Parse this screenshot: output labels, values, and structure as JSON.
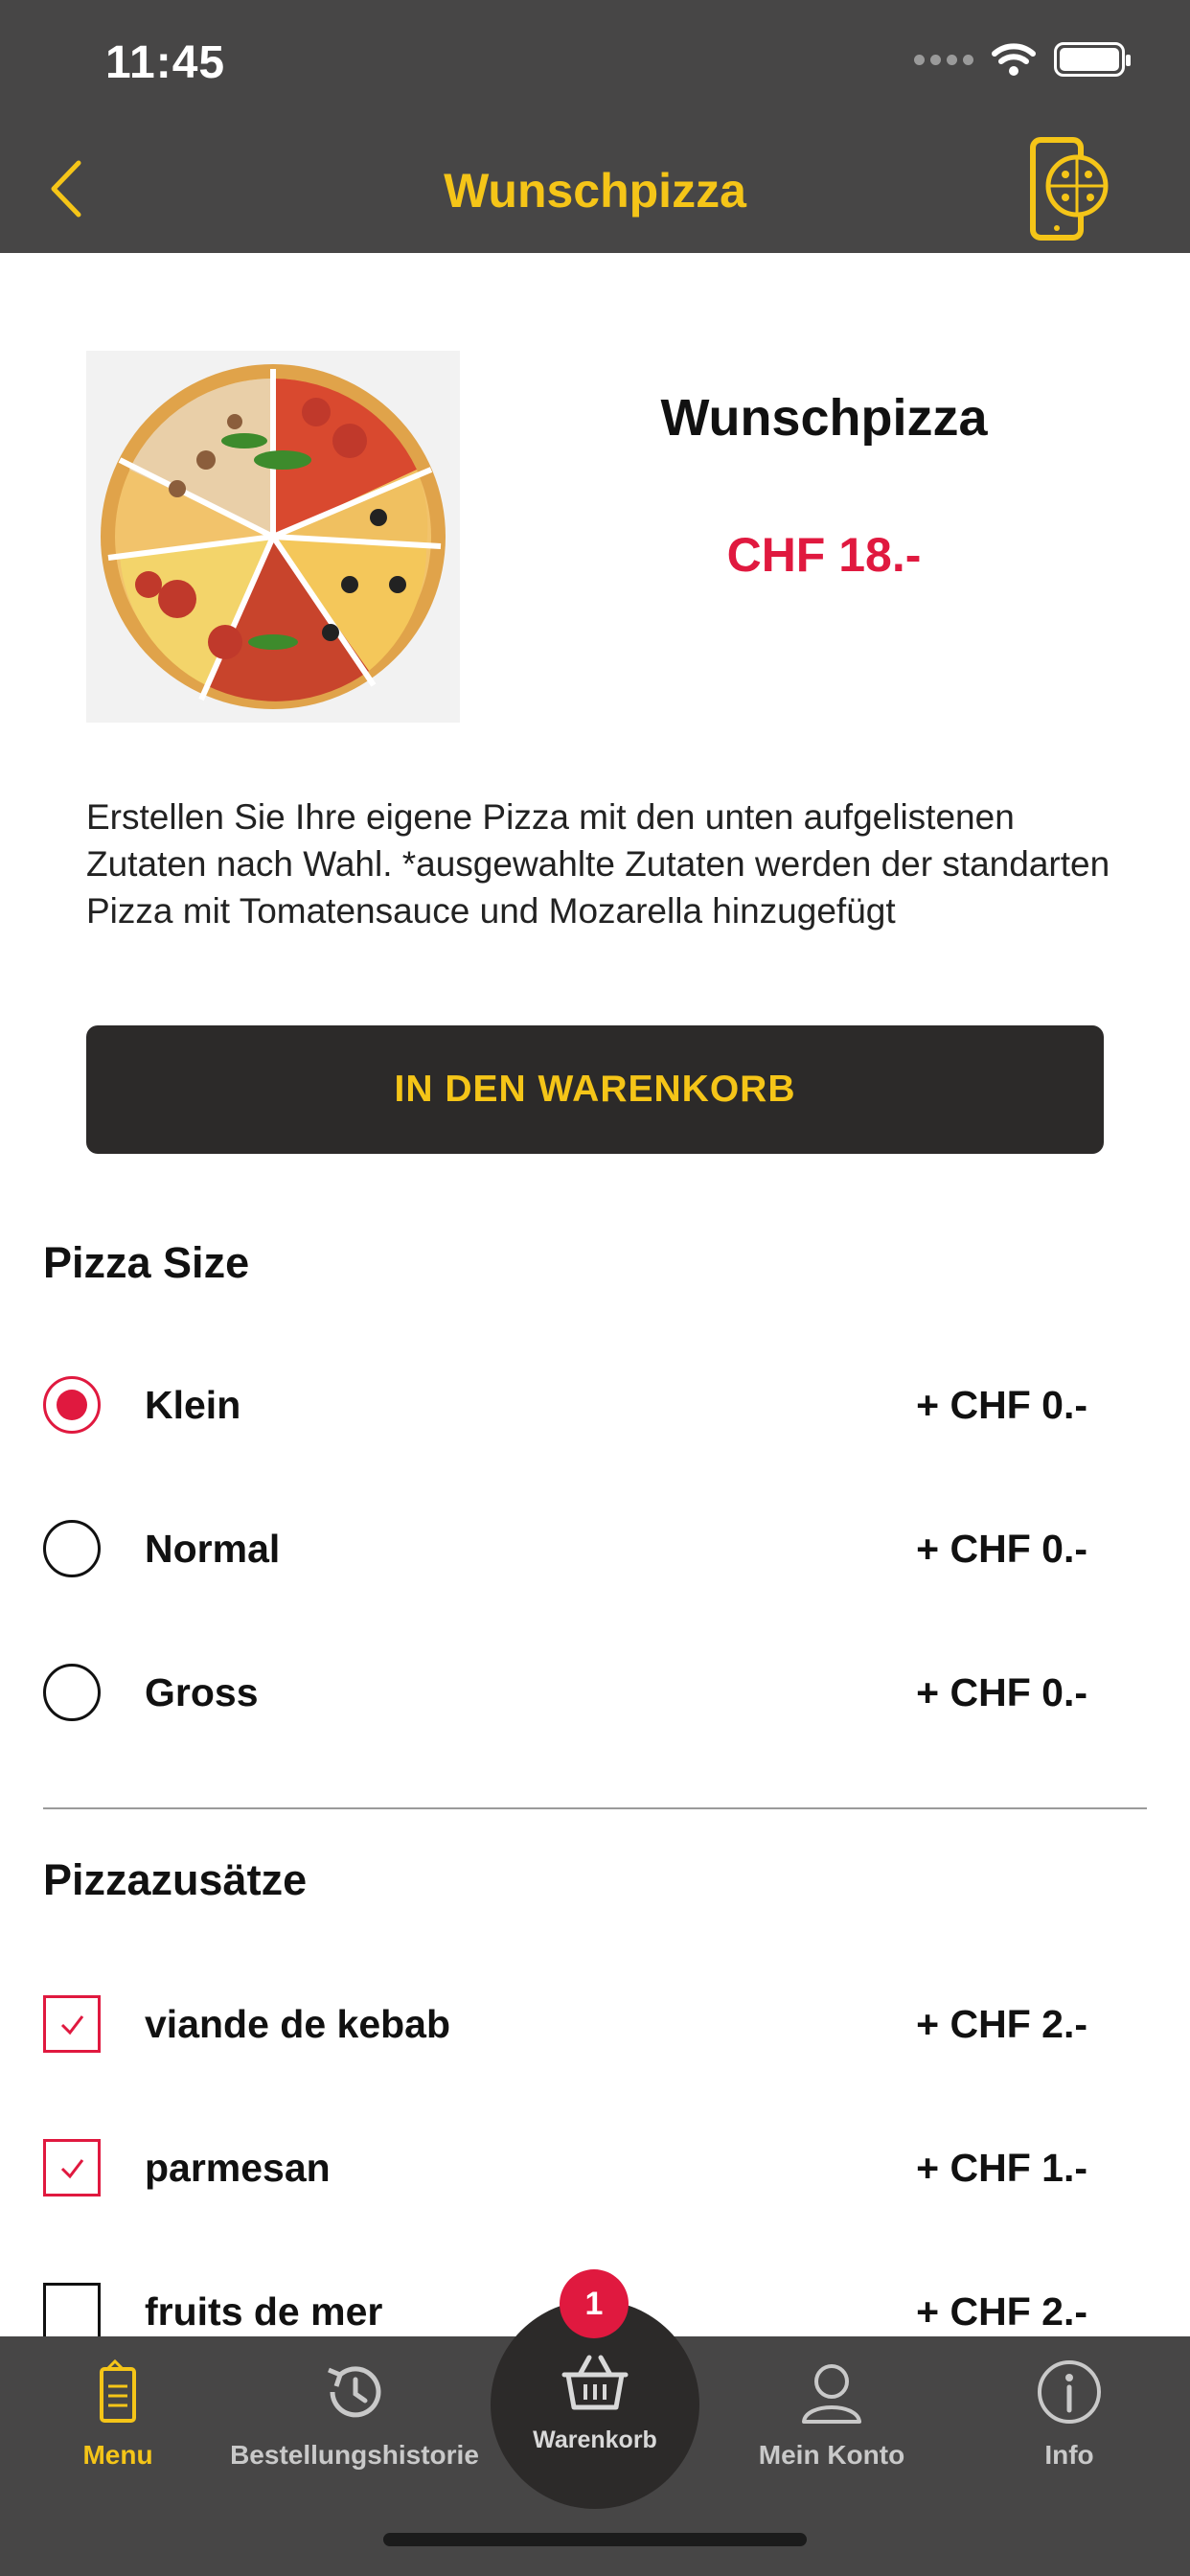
{
  "status_bar": {
    "time": "11:45"
  },
  "nav": {
    "title": "Wunschpizza",
    "icon": "pizza-phone-icon"
  },
  "product": {
    "name": "Wunschpizza",
    "price": "CHF 18.-",
    "description": "Erstellen Sie Ihre eigene Pizza mit den unten aufgelistenen Zutaten nach Wahl. *ausgewahlte Zutaten werden der standarten Pizza mit Tomatensauce und Mozarella hinzugefügt",
    "add_to_cart_label": "IN DEN WARENKORB"
  },
  "pizza_size": {
    "title": "Pizza Size",
    "options": [
      {
        "label": "Klein",
        "price": "+ CHF 0.-",
        "selected": true
      },
      {
        "label": "Normal",
        "price": "+ CHF 0.-",
        "selected": false
      },
      {
        "label": "Gross",
        "price": "+ CHF 0.-",
        "selected": false
      }
    ]
  },
  "extras": {
    "title": "Pizzazusätze",
    "options": [
      {
        "label": "viande de kebab",
        "price": "+ CHF 2.-",
        "checked": true
      },
      {
        "label": "parmesan",
        "price": "+ CHF 1.-",
        "checked": true
      },
      {
        "label": "fruits de mer",
        "price": "+ CHF 2.-",
        "checked": false
      }
    ]
  },
  "tabbar": {
    "tabs": [
      {
        "label": "Menu",
        "icon": "menu-card-icon",
        "active": true
      },
      {
        "label": "Bestellungshistorie",
        "icon": "history-icon",
        "active": false
      },
      {
        "label": "Warenkorb",
        "icon": "basket-icon",
        "active": false,
        "badge": "1"
      },
      {
        "label": "Mein Konto",
        "icon": "user-icon",
        "active": false
      },
      {
        "label": "Info",
        "icon": "info-icon",
        "active": false
      }
    ]
  },
  "colors": {
    "accent": "#f5c518",
    "price": "#e0193f",
    "bar": "#474646",
    "dark": "#2c2a29"
  }
}
